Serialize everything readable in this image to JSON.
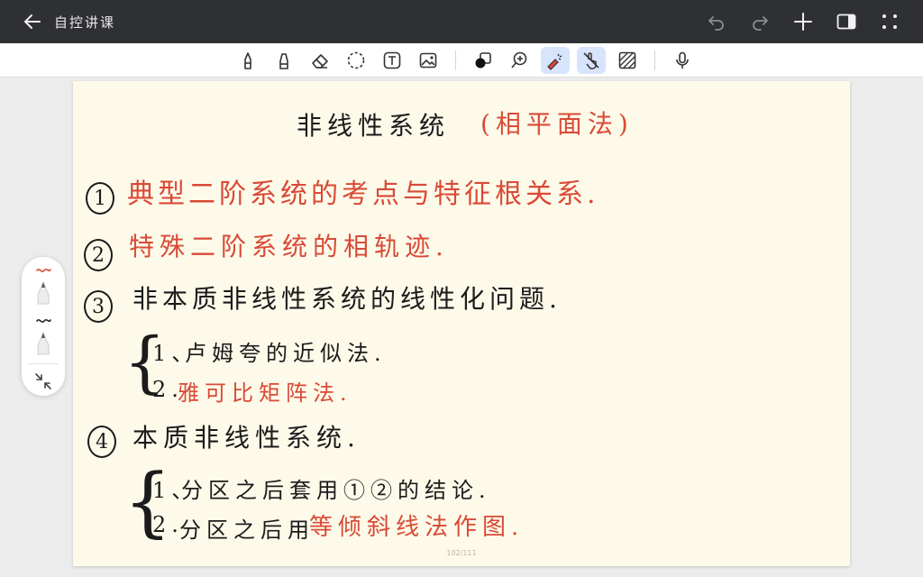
{
  "app": {
    "title": "自控讲课"
  },
  "top_actions": {
    "icons": [
      "undo-icon",
      "redo-icon",
      "plus-icon",
      "sidebar-panel-icon",
      "more-grid-icon"
    ]
  },
  "toolbar": {
    "tools": [
      "pen-icon",
      "highlighter-icon",
      "eraser-icon",
      "lasso-icon",
      "text-box-icon",
      "image-icon",
      "shapes-icon",
      "zoom-icon",
      "laser-pointer-icon",
      "touch-draw-icon",
      "pattern-icon",
      "microphone-icon"
    ],
    "active": [
      "laser-pointer-icon",
      "touch-draw-icon"
    ]
  },
  "note": {
    "title_black": "非线性系统",
    "title_red": "(相平面法)",
    "items": [
      {
        "number": "1",
        "text": "典型二阶系统的考点与特征根关系.",
        "color": "red"
      },
      {
        "number": "2",
        "text": "特殊二阶系统的相轨迹.",
        "color": "red"
      },
      {
        "number": "3",
        "text": "非本质非线性系统的线性化问题.",
        "color": "black"
      },
      {
        "number": "4",
        "text": "本质非线性系统.",
        "color": "black"
      }
    ],
    "sub3": [
      {
        "prefix": "1、",
        "text": "卢姆夸的近似法.",
        "text_color": "black"
      },
      {
        "prefix": "2.",
        "text": "雅可比矩阵法.",
        "text_color": "red"
      }
    ],
    "sub4": [
      {
        "prefix": "1、",
        "text": "分区之后套用①②的结论.",
        "text_color": "black"
      },
      {
        "prefix": "2.",
        "text_black": "分区之后用",
        "text_red": "等倾斜线法作图."
      }
    ],
    "page_indicator": "102/111"
  },
  "colors": {
    "ink_black": "#1b1b1b",
    "ink_red": "#d94a36",
    "paper": "#fdfaea",
    "topbar": "#2f3033",
    "active_tool_bg": "#d7e4fb"
  }
}
